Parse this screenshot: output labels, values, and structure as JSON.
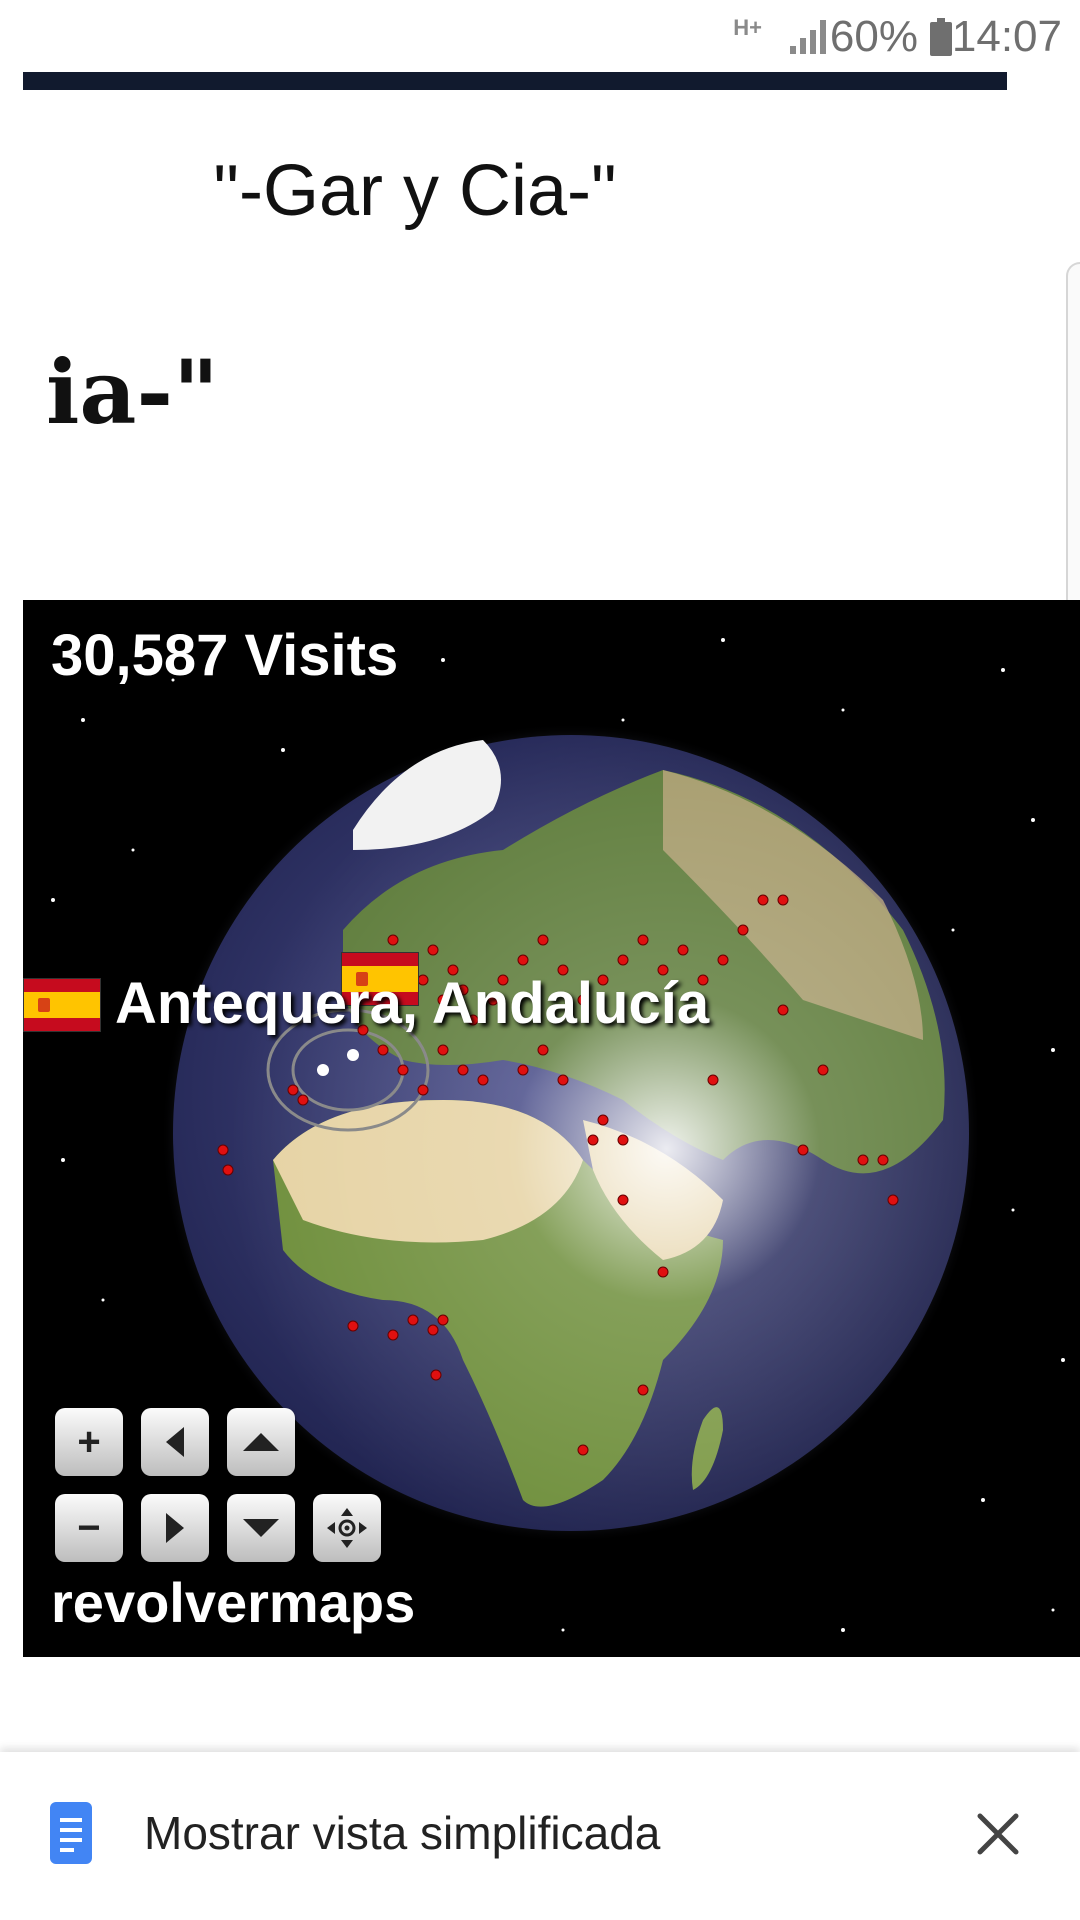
{
  "status_bar": {
    "network": "H+",
    "battery": "60%",
    "time": "14:07"
  },
  "page": {
    "title": "\"-Gar y Cia-\"",
    "heading_partial": "ia-\""
  },
  "widget": {
    "visits": "30,587 Visits",
    "location": "Antequera, Andalucía",
    "brand": "revolvermaps",
    "controls": {
      "zoom_in": "+",
      "zoom_out": "−"
    }
  },
  "banner": {
    "label": "Mostrar vista simplificada"
  },
  "colors": {
    "top_rule": "#111a2e",
    "dot": "#e01010",
    "doc_icon": "#4285f4"
  }
}
